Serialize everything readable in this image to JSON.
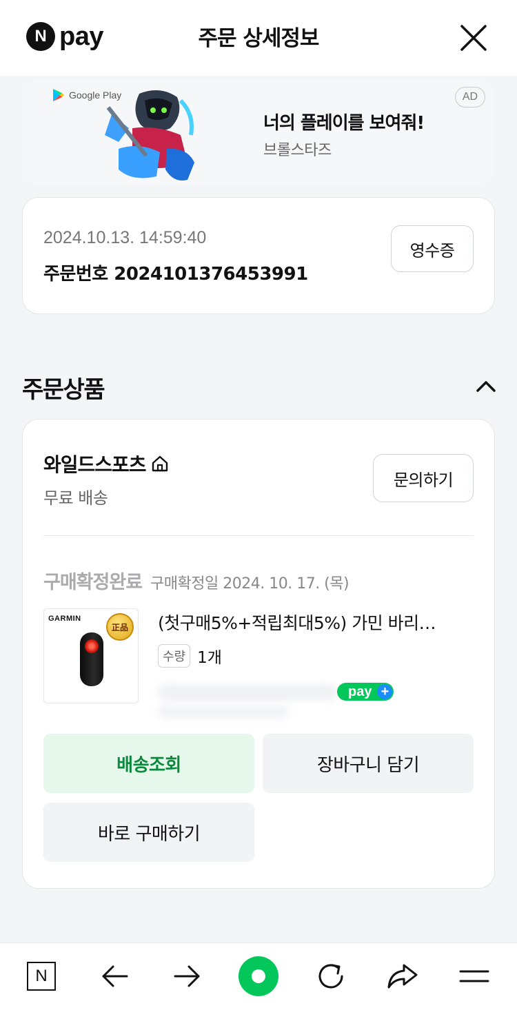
{
  "header": {
    "logo_n": "N",
    "logo_text": "pay",
    "title": "주문 상세정보",
    "close_icon": "close-icon"
  },
  "ad": {
    "store_label": "Google Play",
    "headline": "너의 플레이를 보여줘!",
    "subtitle": "브롤스타즈",
    "badge": "AD"
  },
  "order": {
    "datetime": "2024.10.13. 14:59:40",
    "number": "주문번호 2024101376453991",
    "receipt_label": "영수증"
  },
  "section": {
    "title": "주문상품",
    "toggle_icon": "chevron-up-icon"
  },
  "product": {
    "seller": "와일드스포츠",
    "shipping": "무료 배송",
    "inquiry_label": "문의하기",
    "status": "구매확정완료",
    "confirm_date": "구매확정일 2024. 10. 17. (목)",
    "brand": "GARMIN",
    "genuine_badge": "正品",
    "title": "(첫구매5%+적립최대5%) 가민 바리…",
    "qty_label": "수량",
    "qty_value": "1개",
    "pay_badge": "pay",
    "plus_icon": "+"
  },
  "actions": {
    "tracking": "배송조회",
    "cart": "장바구니 담기",
    "buy_now": "바로 구매하기"
  },
  "bottom_nav": {
    "n_label": "N",
    "items": [
      "naver-home-icon",
      "back-icon",
      "forward-icon",
      "green-dot-icon",
      "refresh-icon",
      "share-icon",
      "menu-icon"
    ]
  },
  "colors": {
    "accent_green": "#03c75a",
    "tracking_text": "#0a8a3c",
    "tracking_bg": "#e6f8ec",
    "background": "#f3f5f7"
  }
}
